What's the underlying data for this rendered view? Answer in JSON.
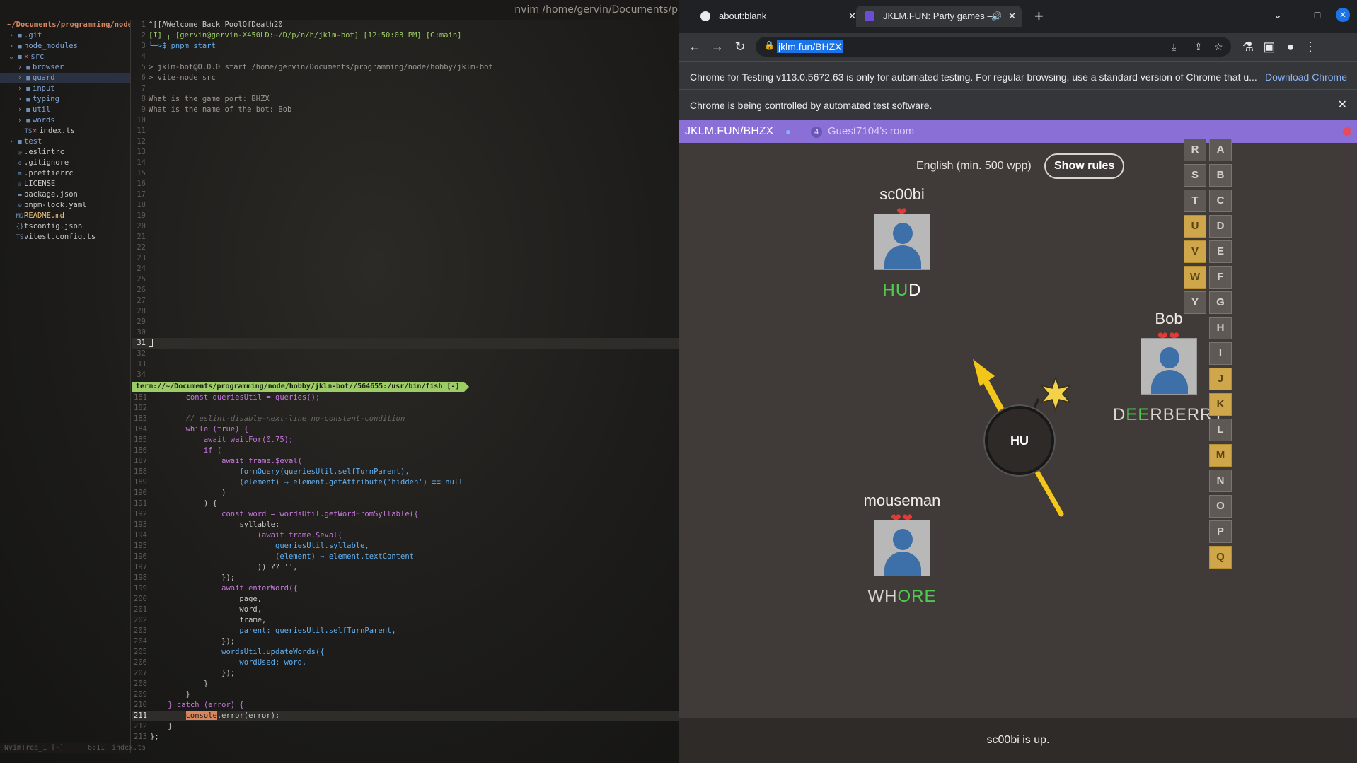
{
  "nvim": {
    "title": "nvim /home/gervin/Documents/p",
    "tree_root": "~/Documents/programming/node",
    "tree": [
      {
        "label": ".git",
        "kind": "folder",
        "depth": 0,
        "arrow": "›"
      },
      {
        "label": "node_modules",
        "kind": "folder",
        "depth": 0,
        "arrow": "›"
      },
      {
        "label": "src",
        "kind": "folder",
        "depth": 0,
        "arrow": "⌄",
        "mark": "✕"
      },
      {
        "label": "browser",
        "kind": "folder",
        "depth": 1,
        "arrow": "›"
      },
      {
        "label": "guard",
        "kind": "folder",
        "depth": 1,
        "arrow": "›",
        "selected": true
      },
      {
        "label": "input",
        "kind": "folder",
        "depth": 1,
        "arrow": "›"
      },
      {
        "label": "typing",
        "kind": "folder",
        "depth": 1,
        "arrow": "›"
      },
      {
        "label": "util",
        "kind": "folder",
        "depth": 1,
        "arrow": "›"
      },
      {
        "label": "words",
        "kind": "folder",
        "depth": 1,
        "arrow": "›"
      },
      {
        "label": "index.ts",
        "kind": "file",
        "depth": 1,
        "icon": "TS",
        "mark": "✕"
      },
      {
        "label": "test",
        "kind": "folder",
        "depth": 0,
        "arrow": "›"
      },
      {
        "label": ".eslintrc",
        "kind": "file",
        "depth": 0,
        "icon": "◎"
      },
      {
        "label": ".gitignore",
        "kind": "file",
        "depth": 0,
        "icon": "◇"
      },
      {
        "label": ".prettierrc",
        "kind": "file",
        "depth": 0,
        "icon": "≡"
      },
      {
        "label": "LICENSE",
        "kind": "file",
        "depth": 0,
        "icon": "♕"
      },
      {
        "label": "package.json",
        "kind": "file",
        "depth": 0,
        "icon": "▬"
      },
      {
        "label": "pnpm-lock.yaml",
        "kind": "file",
        "depth": 0,
        "icon": "⚙"
      },
      {
        "label": "README.md",
        "kind": "file",
        "depth": 0,
        "icon": "MD",
        "modified": true
      },
      {
        "label": "tsconfig.json",
        "kind": "file",
        "depth": 0,
        "icon": "{}"
      },
      {
        "label": "vitest.config.ts",
        "kind": "file",
        "depth": 0,
        "icon": "TS"
      }
    ],
    "tree_status": "NvimTree_1 [-]",
    "terminal_lines": [
      {
        "n": "1",
        "t": "^[[AWelcome Back PoolOfDeath20"
      },
      {
        "n": "2",
        "t": "[I] ┌─[gervin@gervin-X450LD:~/D/p/n/h/jklm-bot]─[12:50:03 PM]─[G:main]"
      },
      {
        "n": "3",
        "t": "└─>$ pnpm start"
      },
      {
        "n": "4",
        "t": ""
      },
      {
        "n": "5",
        "t": "> jklm-bot@0.0.0 start /home/gervin/Documents/programming/node/hobby/jklm-bot"
      },
      {
        "n": "6",
        "t": "> vite-node src"
      },
      {
        "n": "7",
        "t": ""
      },
      {
        "n": "8",
        "t": "What is the game port: BHZX"
      },
      {
        "n": "9",
        "t": "What is the name of the bot: Bob"
      },
      {
        "n": "10",
        "t": ""
      },
      {
        "n": "11",
        "t": ""
      },
      {
        "n": "12",
        "t": ""
      },
      {
        "n": "13",
        "t": ""
      },
      {
        "n": "14",
        "t": ""
      },
      {
        "n": "15",
        "t": ""
      },
      {
        "n": "16",
        "t": ""
      },
      {
        "n": "17",
        "t": ""
      },
      {
        "n": "18",
        "t": ""
      },
      {
        "n": "19",
        "t": ""
      },
      {
        "n": "20",
        "t": ""
      },
      {
        "n": "21",
        "t": ""
      },
      {
        "n": "22",
        "t": ""
      },
      {
        "n": "23",
        "t": ""
      },
      {
        "n": "24",
        "t": ""
      },
      {
        "n": "25",
        "t": ""
      },
      {
        "n": "26",
        "t": ""
      },
      {
        "n": "27",
        "t": ""
      },
      {
        "n": "28",
        "t": ""
      },
      {
        "n": "29",
        "t": ""
      },
      {
        "n": "30",
        "t": ""
      },
      {
        "n": "31",
        "t": "",
        "current": true
      },
      {
        "n": "32",
        "t": ""
      },
      {
        "n": "33",
        "t": ""
      },
      {
        "n": "34",
        "t": ""
      }
    ],
    "term_status": "term://~/Documents/programming/node/hobby/jklm-bot//564655:/usr/bin/fish [-]",
    "code_lines": [
      {
        "n": "181",
        "t": "        const queriesUtil = queries();"
      },
      {
        "n": "182",
        "t": ""
      },
      {
        "n": "183",
        "t": "        // eslint-disable-next-line no-constant-condition"
      },
      {
        "n": "184",
        "t": "        while (true) {"
      },
      {
        "n": "185",
        "t": "            await waitFor(0.75);"
      },
      {
        "n": "186",
        "t": "            if ("
      },
      {
        "n": "187",
        "t": "                await frame.$eval("
      },
      {
        "n": "188",
        "t": "                    formQuery(queriesUtil.selfTurnParent),"
      },
      {
        "n": "189",
        "t": "                    (element) ⇒ element.getAttribute('hidden') ≡≡ null"
      },
      {
        "n": "190",
        "t": "                )"
      },
      {
        "n": "191",
        "t": "            ) {"
      },
      {
        "n": "192",
        "t": "                const word = wordsUtil.getWordFromSyllable({"
      },
      {
        "n": "193",
        "t": "                    syllable:"
      },
      {
        "n": "194",
        "t": "                        (await frame.$eval("
      },
      {
        "n": "195",
        "t": "                            queriesUtil.syllable,"
      },
      {
        "n": "196",
        "t": "                            (element) ⇒ element.textContent"
      },
      {
        "n": "197",
        "t": "                        )) ?? '',"
      },
      {
        "n": "198",
        "t": "                });"
      },
      {
        "n": "199",
        "t": "                await enterWord({"
      },
      {
        "n": "200",
        "t": "                    page,"
      },
      {
        "n": "201",
        "t": "                    word,"
      },
      {
        "n": "202",
        "t": "                    frame,"
      },
      {
        "n": "203",
        "t": "                    parent: queriesUtil.selfTurnParent,"
      },
      {
        "n": "204",
        "t": "                });"
      },
      {
        "n": "205",
        "t": "                wordsUtil.updateWords({"
      },
      {
        "n": "206",
        "t": "                    wordUsed: word,"
      },
      {
        "n": "207",
        "t": "                });"
      },
      {
        "n": "208",
        "t": "            }"
      },
      {
        "n": "209",
        "t": "        }"
      },
      {
        "n": "210",
        "t": "    } catch (error) {"
      },
      {
        "n": "211",
        "t": "        console.error(error);",
        "current": true
      },
      {
        "n": "212",
        "t": "    }"
      },
      {
        "n": "213",
        "t": "};"
      }
    ],
    "code_status_pos": "6:11",
    "code_status_file": "index.ts"
  },
  "chrome": {
    "tabs": [
      {
        "label": "about:blank",
        "active": false
      },
      {
        "label": "JKLM.FUN: Party games –",
        "active": true
      }
    ],
    "new_tab": "+",
    "url": "jklm.fun/BHZX",
    "info_testing": "Chrome for Testing v113.0.5672.63 is only for automated testing. For regular browsing, use a standard version of Chrome that u...",
    "info_link": "Download Chrome",
    "info_automation": "Chrome is being controlled by automated test software."
  },
  "game": {
    "room_code": "JKLM.FUN/BHZX",
    "player_count": "4",
    "room_name": "Guest7104's room",
    "rules_text": "English (min. 500 wpp)",
    "show_rules": "Show rules",
    "syllable": "HU",
    "players": [
      {
        "name": "sc00bi",
        "hearts": "❤",
        "word_pre": "",
        "word_hit": "HU",
        "word_post": "D",
        "post_done": true
      },
      {
        "name": "Bob",
        "hearts": "❤❤",
        "word_pre": "D",
        "word_hit": "EE",
        "word_post": "RBERRY",
        "post_done": false
      },
      {
        "name": "mouseman",
        "hearts": "❤❤",
        "word_pre": "WH",
        "word_hit": "ORE",
        "word_post": "",
        "post_done": false
      }
    ],
    "alphabet": [
      {
        "l": "R",
        "used": false
      },
      {
        "l": "S",
        "used": false
      },
      {
        "l": "T",
        "used": false
      },
      {
        "l": "U",
        "used": true
      },
      {
        "l": "V",
        "used": true
      },
      {
        "l": "W",
        "used": true
      },
      {
        "l": "Y",
        "used": false
      },
      {
        "l": "A",
        "used": false
      },
      {
        "l": "B",
        "used": false
      },
      {
        "l": "C",
        "used": false
      },
      {
        "l": "D",
        "used": false
      },
      {
        "l": "E",
        "used": false
      },
      {
        "l": "F",
        "used": false
      },
      {
        "l": "G",
        "used": false
      },
      {
        "l": "H",
        "used": false
      },
      {
        "l": "I",
        "used": false
      },
      {
        "l": "J",
        "used": true
      },
      {
        "l": "K",
        "used": true
      },
      {
        "l": "L",
        "used": false
      },
      {
        "l": "M",
        "used": true
      },
      {
        "l": "N",
        "used": false
      },
      {
        "l": "O",
        "used": false
      },
      {
        "l": "P",
        "used": false
      },
      {
        "l": "Q",
        "used": true
      }
    ],
    "footer": "sc00bi is up."
  }
}
